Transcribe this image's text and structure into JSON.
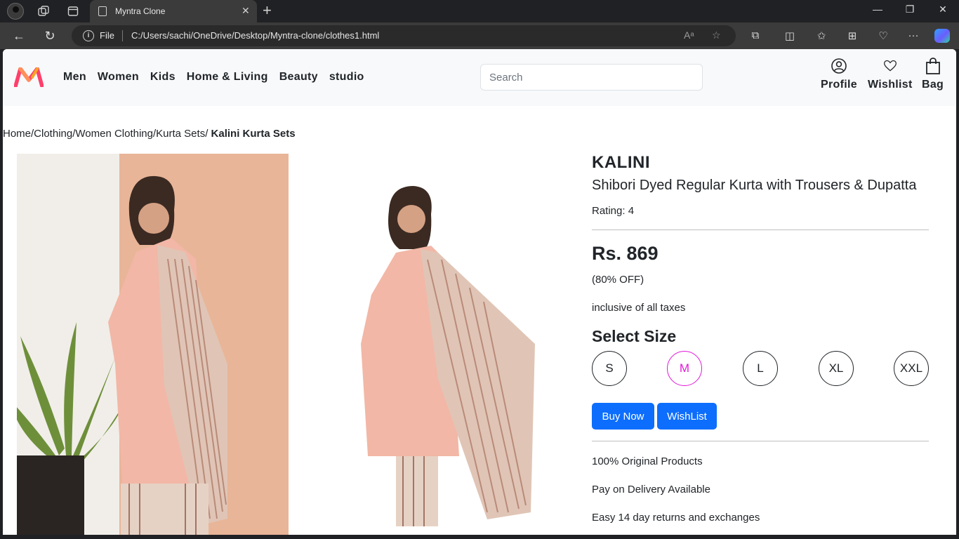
{
  "browser": {
    "tab_title": "Myntra Clone",
    "url_scheme_label": "File",
    "url": "C:/Users/sachi/OneDrive/Desktop/Myntra-clone/clothes1.html"
  },
  "header": {
    "nav": [
      "Men",
      "Women",
      "Kids",
      "Home & Living",
      "Beauty",
      "studio"
    ],
    "search_placeholder": "Search",
    "actions": {
      "profile": "Profile",
      "wishlist": "Wishlist",
      "bag": "Bag"
    }
  },
  "breadcrumb": {
    "path": "Home/Clothing/Women Clothing/Kurta Sets/",
    "current": " Kalini Kurta Sets"
  },
  "product": {
    "brand": "KALINI",
    "name": "Shibori Dyed Regular Kurta with Trousers & Dupatta",
    "rating": "Rating: 4",
    "price": "Rs. 869",
    "discount": "(80% OFF)",
    "taxes": "inclusive of all taxes",
    "size_title": "Select Size",
    "sizes": [
      "S",
      "M",
      "L",
      "XL",
      "XXL"
    ],
    "selected_size": "M",
    "buy_label": "Buy Now",
    "wishlist_label": "WishList",
    "features": [
      "100% Original Products",
      "Pay on Delivery Available",
      "Easy 14 day returns and exchanges"
    ]
  },
  "colors": {
    "accent": "#0d6efd",
    "selected_size": "#e21ad9",
    "logo_pink": "#ff3f6c",
    "logo_orange": "#ff905a"
  }
}
